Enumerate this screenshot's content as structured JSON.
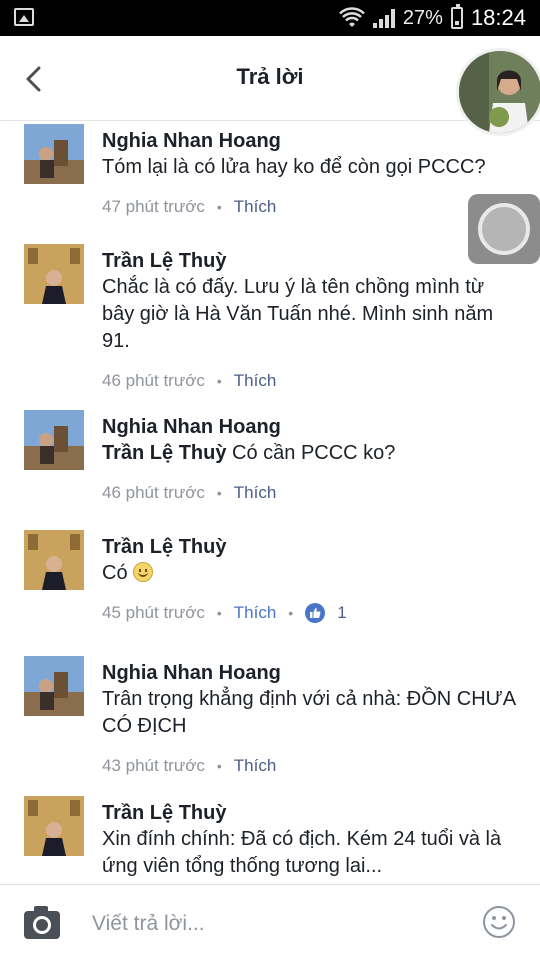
{
  "status_bar": {
    "battery": "27%",
    "time": "18:24"
  },
  "header": {
    "title": "Trả lời"
  },
  "comments": [
    {
      "author": "Nghia Nhan Hoang",
      "text": "Tóm lại là có lửa hay ko để còn gọi PCCC?",
      "time": "47 phút trước",
      "like_label": "Thích"
    },
    {
      "author": "Trần Lệ Thuỳ",
      "text": "Chắc là có đấy. Lưu ý là tên chồng mình từ bây giờ là Hà Văn Tuấn nhé. Mình sinh năm 91.",
      "time": "46 phút trước",
      "like_label": "Thích"
    },
    {
      "author": "Nghia Nhan Hoang",
      "mention": "Trần Lệ Thuỳ",
      "text": " Có cần PCCC ko?",
      "time": "46 phút trước",
      "like_label": "Thích"
    },
    {
      "author": "Trần Lệ Thuỳ",
      "text": "Có ",
      "time": "45 phút trước",
      "like_label": "Thích",
      "like_count": "1"
    },
    {
      "author": "Nghia Nhan Hoang",
      "text": "Trân trọng khẳng định với cả nhà: ĐỒN CHƯA CÓ ĐỊCH",
      "time": "43 phút trước",
      "like_label": "Thích"
    },
    {
      "author": "Trần Lệ Thuỳ",
      "text": "Xin đính chính: Đã có địch. Kém 24 tuổi và là ứng viên tổng thống tương lai..."
    }
  ],
  "composer": {
    "placeholder": "Viết trả lời..."
  },
  "colors": {
    "link": "#4b5e86",
    "like_active": "#4a76c9",
    "meta": "#90949c"
  }
}
